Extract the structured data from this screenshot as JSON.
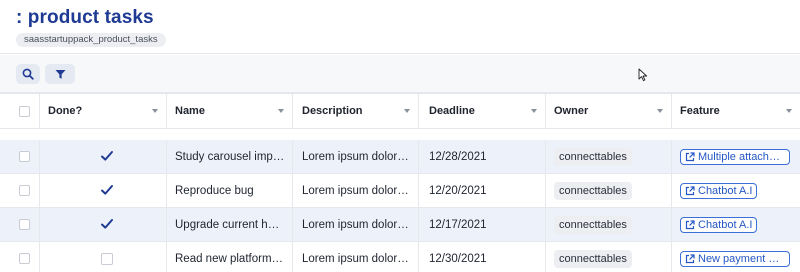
{
  "header": {
    "title": ": product tasks",
    "table_name": "saasstartuppack_product_tasks"
  },
  "toolbar": {
    "search_icon": "search-icon",
    "filter_icon": "filter-icon"
  },
  "colors": {
    "title": "#1f3a93",
    "accent": "#2457c5",
    "row_alt": "#edf2fa"
  },
  "table": {
    "columns": [
      "Done?",
      "Name",
      "Description",
      "Deadline",
      "Owner",
      "Feature"
    ],
    "rows": [
      {
        "done": true,
        "name": "Study carousel implementation",
        "description": "Lorem ipsum dolor sit amet",
        "deadline": "12/28/2021",
        "owner": "connecttables",
        "feature": "Multiple attachments"
      },
      {
        "done": true,
        "name": "Reproduce bug",
        "description": "Lorem ipsum dolor sit amet",
        "deadline": "12/20/2021",
        "owner": "connecttables",
        "feature": "Chatbot A.I"
      },
      {
        "done": true,
        "name": "Upgrade current hardware",
        "description": "Lorem ipsum dolor sit amet",
        "deadline": "12/17/2021",
        "owner": "connecttables",
        "feature": "Chatbot A.I"
      },
      {
        "done": false,
        "name": "Read new platform's documentation",
        "description": "Lorem ipsum dolor sit amet",
        "deadline": "12/30/2021",
        "owner": "connecttables",
        "feature": "New payment platform"
      }
    ]
  }
}
